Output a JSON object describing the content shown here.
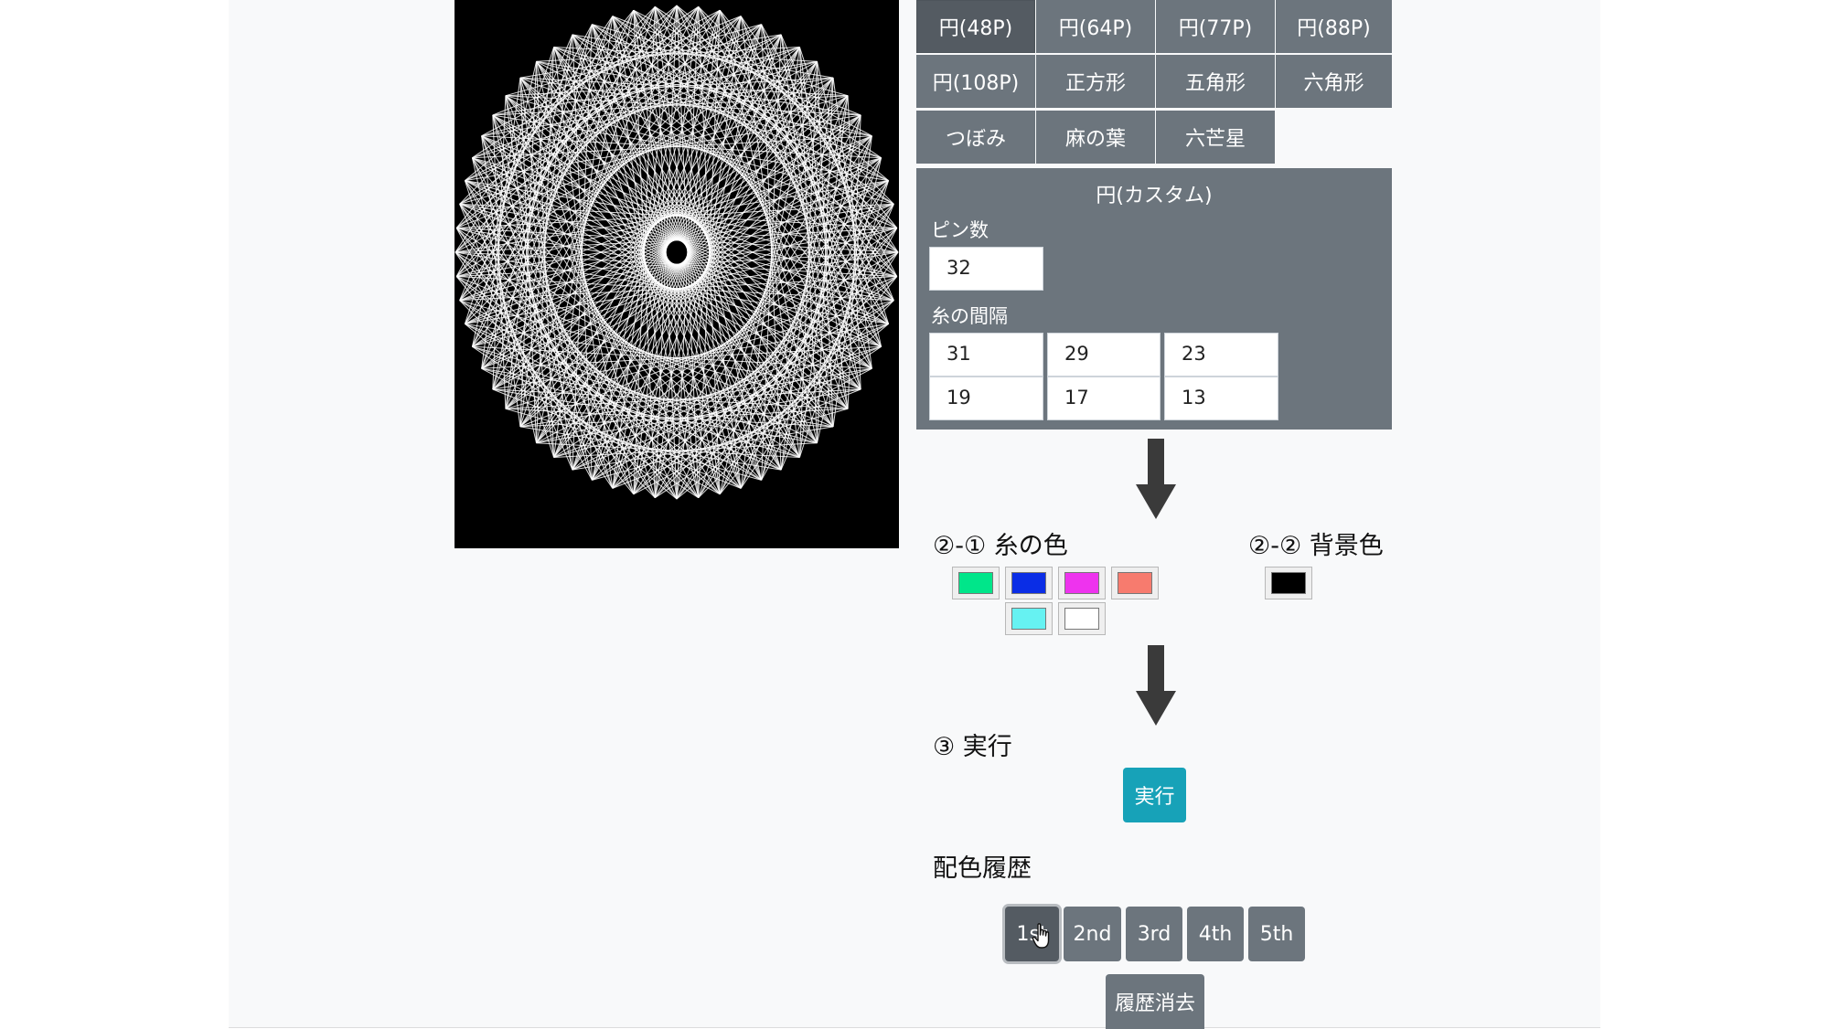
{
  "shapes": {
    "items": [
      {
        "label": "円(48P)",
        "active": true
      },
      {
        "label": "円(64P)"
      },
      {
        "label": "円(77P)"
      },
      {
        "label": "円(88P)"
      },
      {
        "label": "円(108P)"
      },
      {
        "label": "正方形"
      },
      {
        "label": "五角形"
      },
      {
        "label": "六角形"
      },
      {
        "label": "つぼみ"
      },
      {
        "label": "麻の葉"
      },
      {
        "label": "六芒星"
      }
    ]
  },
  "custom": {
    "title": "円(カスタム)",
    "pins_label": "ピン数",
    "pins_value": "32",
    "spacing_label": "糸の間隔",
    "spacing_values": [
      "31",
      "29",
      "23",
      "19",
      "17",
      "13"
    ]
  },
  "colors": {
    "thread_heading": "②-① 糸の色",
    "background_heading": "②-② 背景色",
    "thread_swatches": [
      "#00e68a",
      "#0a2de6",
      "#ee33ee",
      "#f77b6e",
      "#66f2f2",
      "#ffffff"
    ],
    "background_swatch": "#000000",
    "arrow_color": "#3a3a3a"
  },
  "run": {
    "heading": "③ 実行",
    "button_label": "実行",
    "accent": "#17a2b8"
  },
  "history": {
    "heading": "配色履歴",
    "buttons": [
      "1st",
      "2nd",
      "3rd",
      "4th",
      "5th"
    ],
    "clear_label": "履歴消去"
  }
}
